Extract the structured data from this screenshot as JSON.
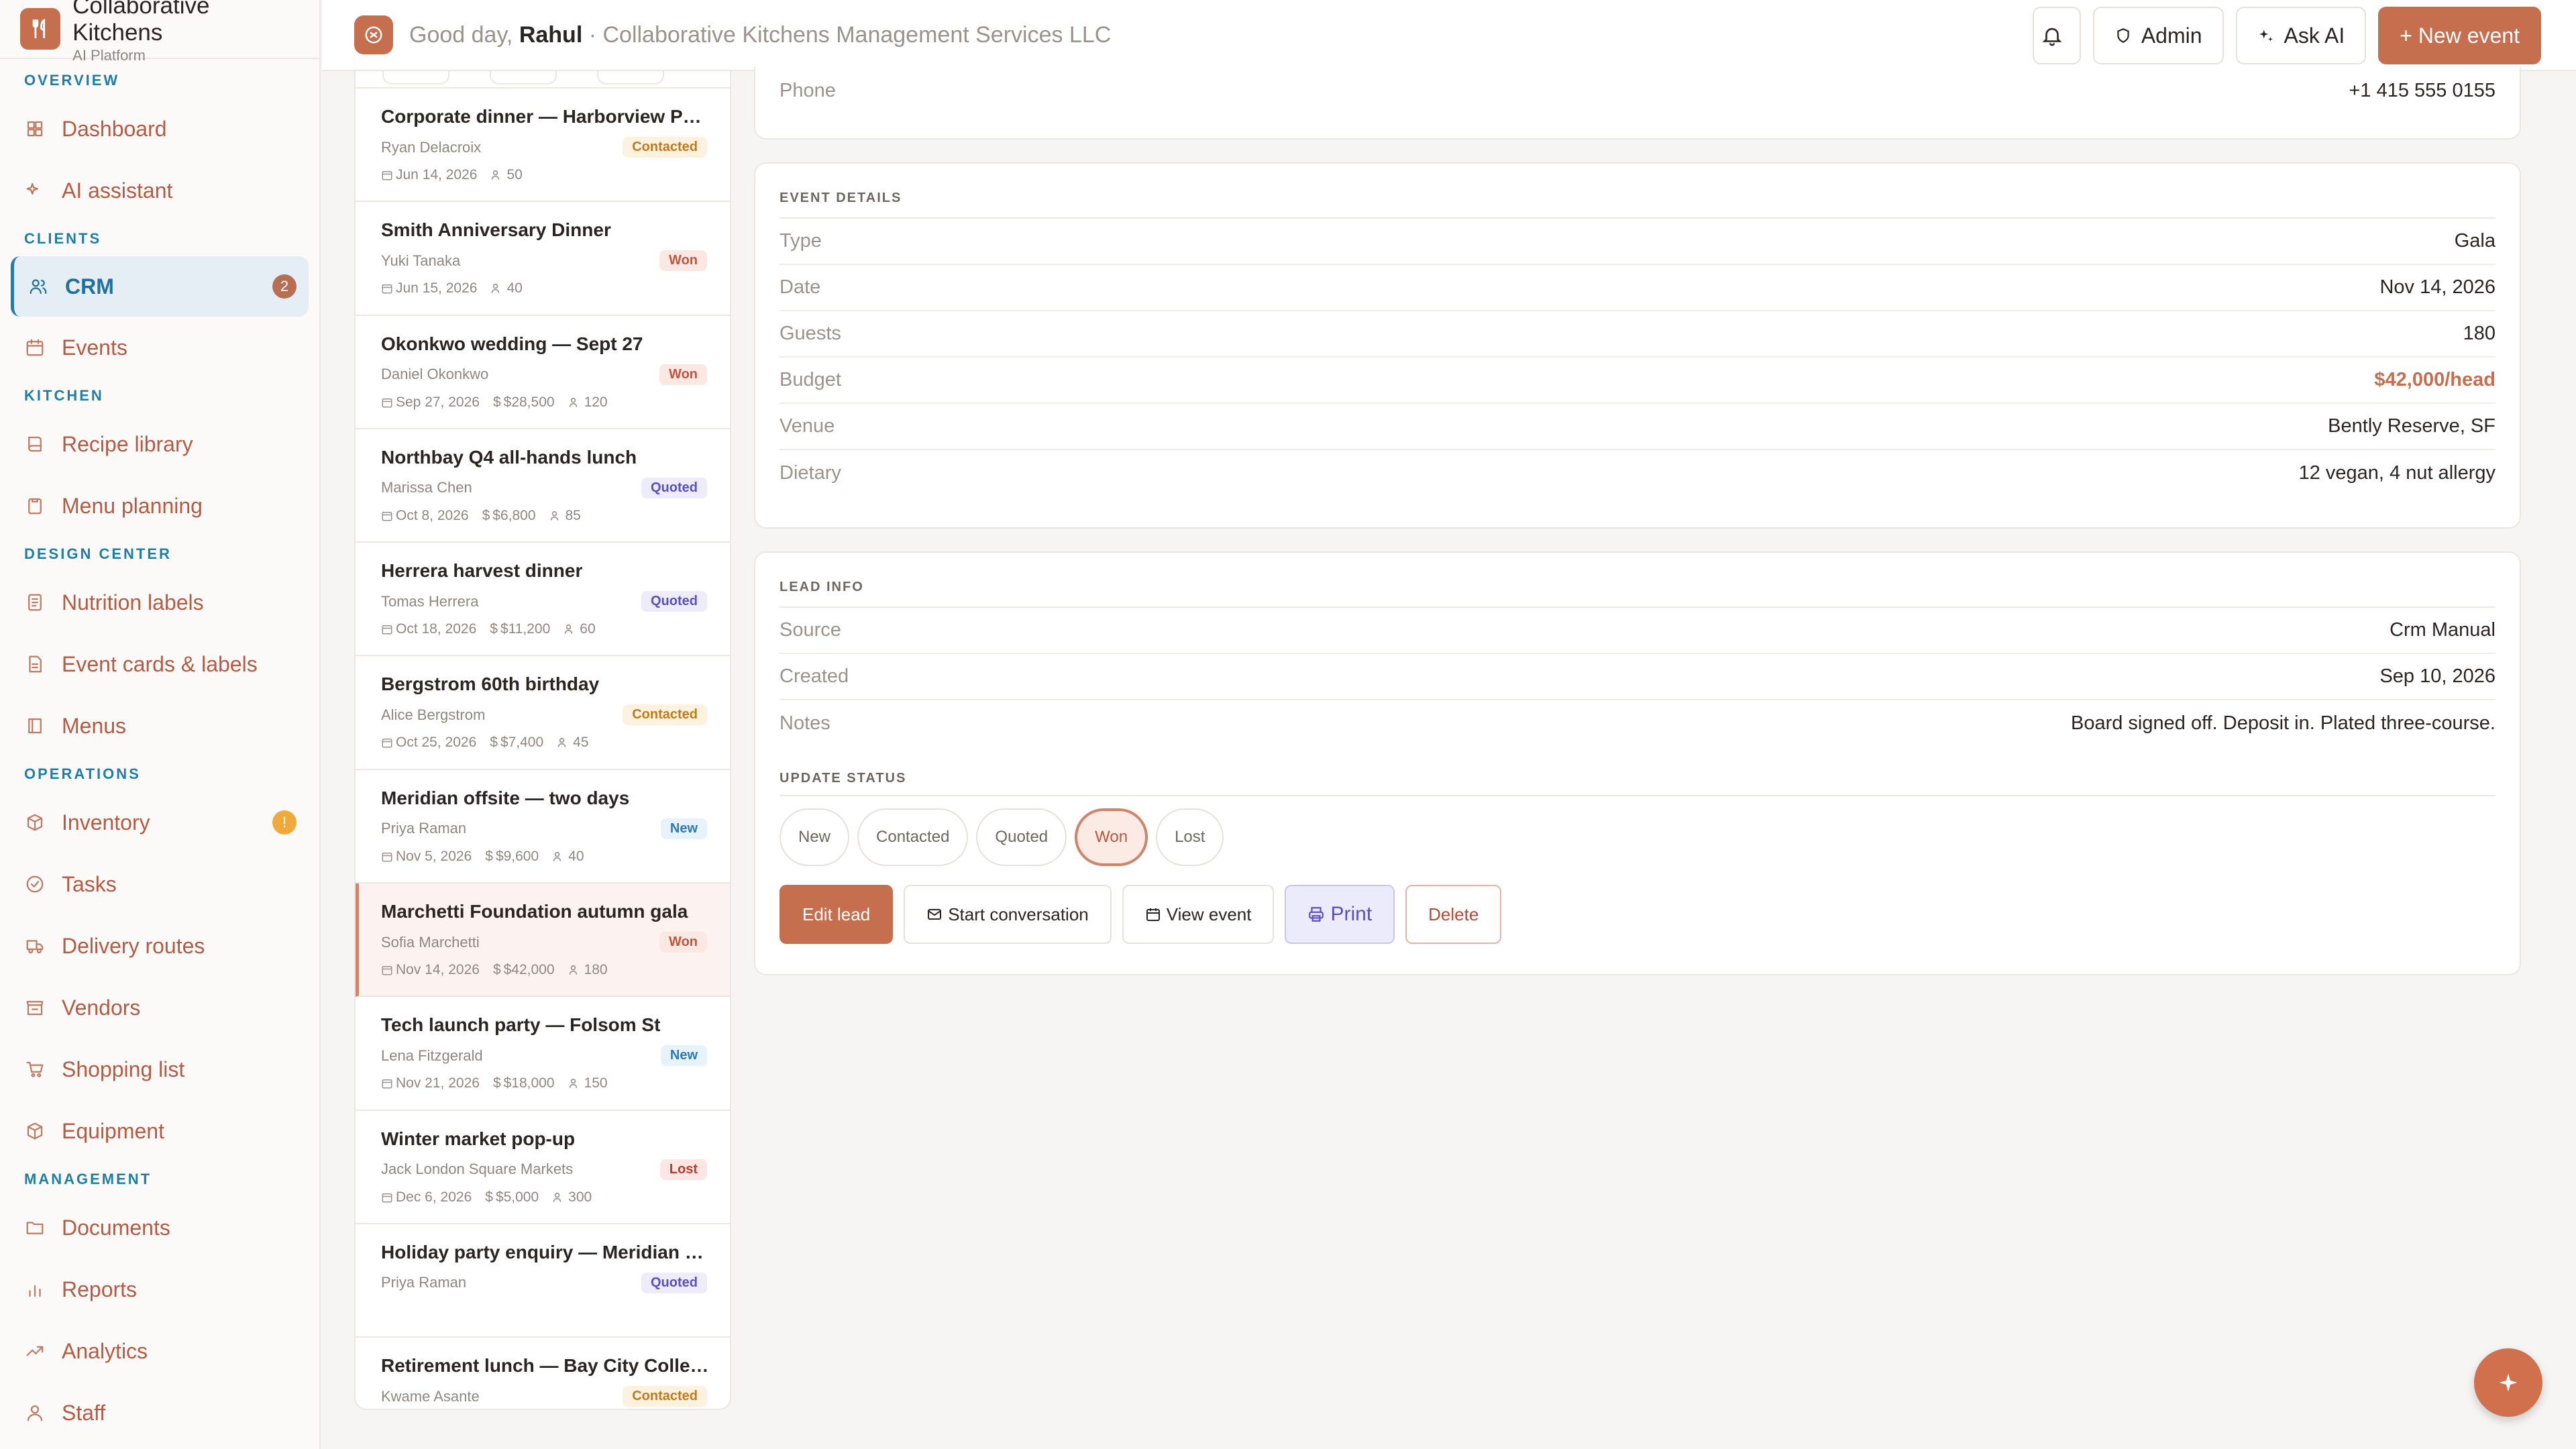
{
  "brand": {
    "name": "Collaborative Kitchens",
    "subtitle": "AI Platform"
  },
  "sidebar": {
    "sections": [
      {
        "title": "OVERVIEW",
        "items": [
          {
            "label": "Dashboard",
            "icon": "grid-icon"
          },
          {
            "label": "AI assistant",
            "icon": "sparkle-icon"
          }
        ]
      },
      {
        "title": "CLIENTS",
        "items": [
          {
            "label": "CRM",
            "icon": "users-icon",
            "badge": "2",
            "active": true
          },
          {
            "label": "Events",
            "icon": "calendar-icon"
          }
        ]
      },
      {
        "title": "KITCHEN",
        "items": [
          {
            "label": "Recipe library",
            "icon": "book-icon"
          },
          {
            "label": "Menu planning",
            "icon": "clipboard-icon"
          }
        ]
      },
      {
        "title": "DESIGN CENTER",
        "items": [
          {
            "label": "Nutrition labels",
            "icon": "label-icon"
          },
          {
            "label": "Event cards & labels",
            "icon": "card-icon"
          },
          {
            "label": "Menus",
            "icon": "menu-book-icon"
          }
        ]
      },
      {
        "title": "OPERATIONS",
        "items": [
          {
            "label": "Inventory",
            "icon": "box-icon",
            "badge": "!"
          },
          {
            "label": "Tasks",
            "icon": "check-circle-icon"
          },
          {
            "label": "Delivery routes",
            "icon": "truck-icon"
          },
          {
            "label": "Vendors",
            "icon": "store-icon"
          },
          {
            "label": "Shopping list",
            "icon": "cart-icon"
          },
          {
            "label": "Equipment",
            "icon": "cube-icon"
          }
        ]
      },
      {
        "title": "MANAGEMENT",
        "items": [
          {
            "label": "Documents",
            "icon": "folder-icon"
          },
          {
            "label": "Reports",
            "icon": "bar-chart-icon"
          },
          {
            "label": "Analytics",
            "icon": "trend-icon"
          },
          {
            "label": "Staff",
            "icon": "staff-icon"
          }
        ]
      }
    ]
  },
  "header": {
    "greeting_prefix": "Good day, ",
    "user_name": "Rahul",
    "company": " · Collaborative Kitchens Management Services LLC",
    "admin_label": "Admin",
    "ask_ai_label": "Ask AI",
    "new_event_label": "+ New event"
  },
  "leads": [
    {
      "title": "Corporate dinner — Harborview Partners",
      "client": "Ryan Delacroix",
      "status": "Contacted",
      "date": "Jun 14, 2026",
      "amount": "",
      "guests": "50"
    },
    {
      "title": "Smith Anniversary Dinner",
      "client": "Yuki Tanaka",
      "status": "Won",
      "date": "Jun 15, 2026",
      "amount": "",
      "guests": "40"
    },
    {
      "title": "Okonkwo wedding — Sept 27",
      "client": "Daniel Okonkwo",
      "status": "Won",
      "date": "Sep 27, 2026",
      "amount": "$28,500",
      "guests": "120"
    },
    {
      "title": "Northbay Q4 all-hands lunch",
      "client": "Marissa Chen",
      "status": "Quoted",
      "date": "Oct 8, 2026",
      "amount": "$6,800",
      "guests": "85"
    },
    {
      "title": "Herrera harvest dinner",
      "client": "Tomas Herrera",
      "status": "Quoted",
      "date": "Oct 18, 2026",
      "amount": "$11,200",
      "guests": "60"
    },
    {
      "title": "Bergstrom 60th birthday",
      "client": "Alice Bergstrom",
      "status": "Contacted",
      "date": "Oct 25, 2026",
      "amount": "$7,400",
      "guests": "45"
    },
    {
      "title": "Meridian offsite — two days",
      "client": "Priya Raman",
      "status": "New",
      "date": "Nov 5, 2026",
      "amount": "$9,600",
      "guests": "40"
    },
    {
      "title": "Marchetti Foundation autumn gala",
      "client": "Sofia Marchetti",
      "status": "Won",
      "date": "Nov 14, 2026",
      "amount": "$42,000",
      "guests": "180",
      "selected": true
    },
    {
      "title": "Tech launch party — Folsom St",
      "client": "Lena Fitzgerald",
      "status": "New",
      "date": "Nov 21, 2026",
      "amount": "$18,000",
      "guests": "150"
    },
    {
      "title": "Winter market pop-up",
      "client": "Jack London Square Markets",
      "status": "Lost",
      "date": "Dec 6, 2026",
      "amount": "$5,000",
      "guests": "300"
    },
    {
      "title": "Holiday party enquiry — Meridian Labs",
      "client": "Priya Raman",
      "status": "Quoted",
      "date": "",
      "amount": "",
      "guests": ""
    },
    {
      "title": "Retirement lunch — Bay City College",
      "client": "Kwame Asante",
      "status": "Contacted",
      "date": "",
      "amount": "",
      "guests": ""
    }
  ],
  "contact": {
    "phone_label": "Phone",
    "phone": "+1 415 555 0155"
  },
  "event_details": {
    "heading": "EVENT DETAILS",
    "rows": [
      {
        "k": "Type",
        "v": "Gala"
      },
      {
        "k": "Date",
        "v": "Nov 14, 2026"
      },
      {
        "k": "Guests",
        "v": "180"
      },
      {
        "k": "Budget",
        "v": "$42,000/head",
        "accent": true
      },
      {
        "k": "Venue",
        "v": "Bently Reserve, SF"
      },
      {
        "k": "Dietary",
        "v": "12 vegan, 4 nut allergy"
      }
    ]
  },
  "lead_info": {
    "heading": "LEAD INFO",
    "rows": [
      {
        "k": "Source",
        "v": "Crm Manual"
      },
      {
        "k": "Created",
        "v": "Sep 10, 2026"
      },
      {
        "k": "Notes",
        "v": "Board signed off. Deposit in. Plated three-course."
      }
    ],
    "update_status_heading": "UPDATE STATUS",
    "statuses": [
      "New",
      "Contacted",
      "Quoted",
      "Won",
      "Lost"
    ],
    "current_status": "Won"
  },
  "actions": {
    "edit": "Edit lead",
    "start_conversation": "Start conversation",
    "view_event": "View event",
    "print": "Print",
    "delete": "Delete"
  },
  "colors": {
    "accent": "#c56f4f",
    "link_blue": "#1f7ea6"
  }
}
